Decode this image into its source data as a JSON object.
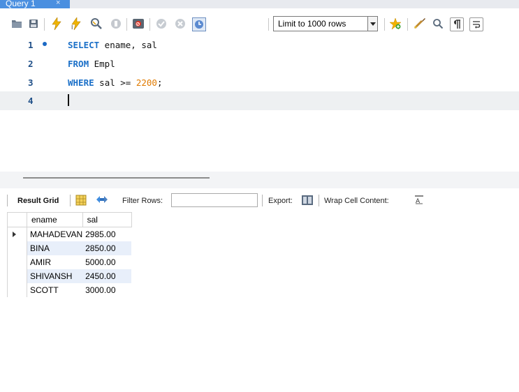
{
  "tab": {
    "title": "Query 1",
    "close": "×"
  },
  "toolbar": {
    "limit_value": "Limit to 1000 rows",
    "icons": [
      "open-folder-icon",
      "save-icon",
      "execute-icon",
      "execute-current-icon",
      "explain-icon",
      "stop-icon",
      "toggle-continue-icon",
      "commit-icon",
      "rollback-icon",
      "autocommit-icon",
      "beautify-icon",
      "find-icon",
      "invisible-chars-icon",
      "wrap-icon",
      "bookmark-icon"
    ]
  },
  "editor": {
    "lines": [
      {
        "num": "1",
        "kw1": "SELECT",
        "rest": " ename, sal"
      },
      {
        "num": "2",
        "kw1": "FROM",
        "rest": " Empl"
      },
      {
        "num": "3",
        "kw1": "WHERE",
        "rest": " sal >= ",
        "num_value": "2200",
        "tail": ";"
      },
      {
        "num": "4"
      }
    ]
  },
  "results": {
    "result_grid_label": "Result Grid",
    "filter_label": "Filter Rows:",
    "filter_value": "",
    "export_label": "Export:",
    "wrap_label": "Wrap Cell Content:",
    "columns": [
      "ename",
      "sal"
    ],
    "rows": [
      {
        "ename": "MAHADEVAN",
        "sal": "2985.00"
      },
      {
        "ename": "BINA",
        "sal": "2850.00"
      },
      {
        "ename": "AMIR",
        "sal": "5000.00"
      },
      {
        "ename": "SHIVANSH",
        "sal": "2450.00"
      },
      {
        "ename": "SCOTT",
        "sal": "3000.00"
      }
    ]
  },
  "colors": {
    "tab_active": "#4a8fe0",
    "keyword": "#1b70c8",
    "number": "#e07a00",
    "line_number": "#1e4e87",
    "row_alt": "#e8effa"
  }
}
